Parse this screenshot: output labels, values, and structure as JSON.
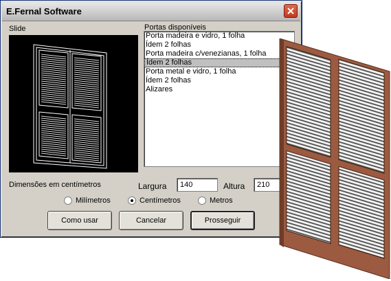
{
  "window": {
    "title": "E.Fernal Software"
  },
  "slide": {
    "label": "Slide"
  },
  "list": {
    "label": "Portas disponíveis",
    "items": [
      "Porta madeira e vidro, 1 folha",
      "Ídem 2 folhas",
      "Porta madeira c/venezianas, 1 folha",
      "Ídem 2 folhas",
      "Porta metal e vidro, 1 folha",
      "Ídem 2 folhas",
      "Alizares"
    ],
    "selected_index": 3
  },
  "dimensions": {
    "label": "Dimensões em centímetros",
    "width_label": "Largura",
    "width_value": "140",
    "height_label": "Altura",
    "height_value": "210"
  },
  "units": {
    "options": [
      "Milímetros",
      "Centímetros",
      "Metros"
    ],
    "selected": "Centímetros"
  },
  "buttons": {
    "how_to_use": "Como usar",
    "cancel": "Cancelar",
    "proceed": "Prosseguir"
  },
  "colors": {
    "selected_row": "#c0c0c0",
    "door_frame": "#9c5a40"
  },
  "icons": {
    "close": "close-icon"
  }
}
